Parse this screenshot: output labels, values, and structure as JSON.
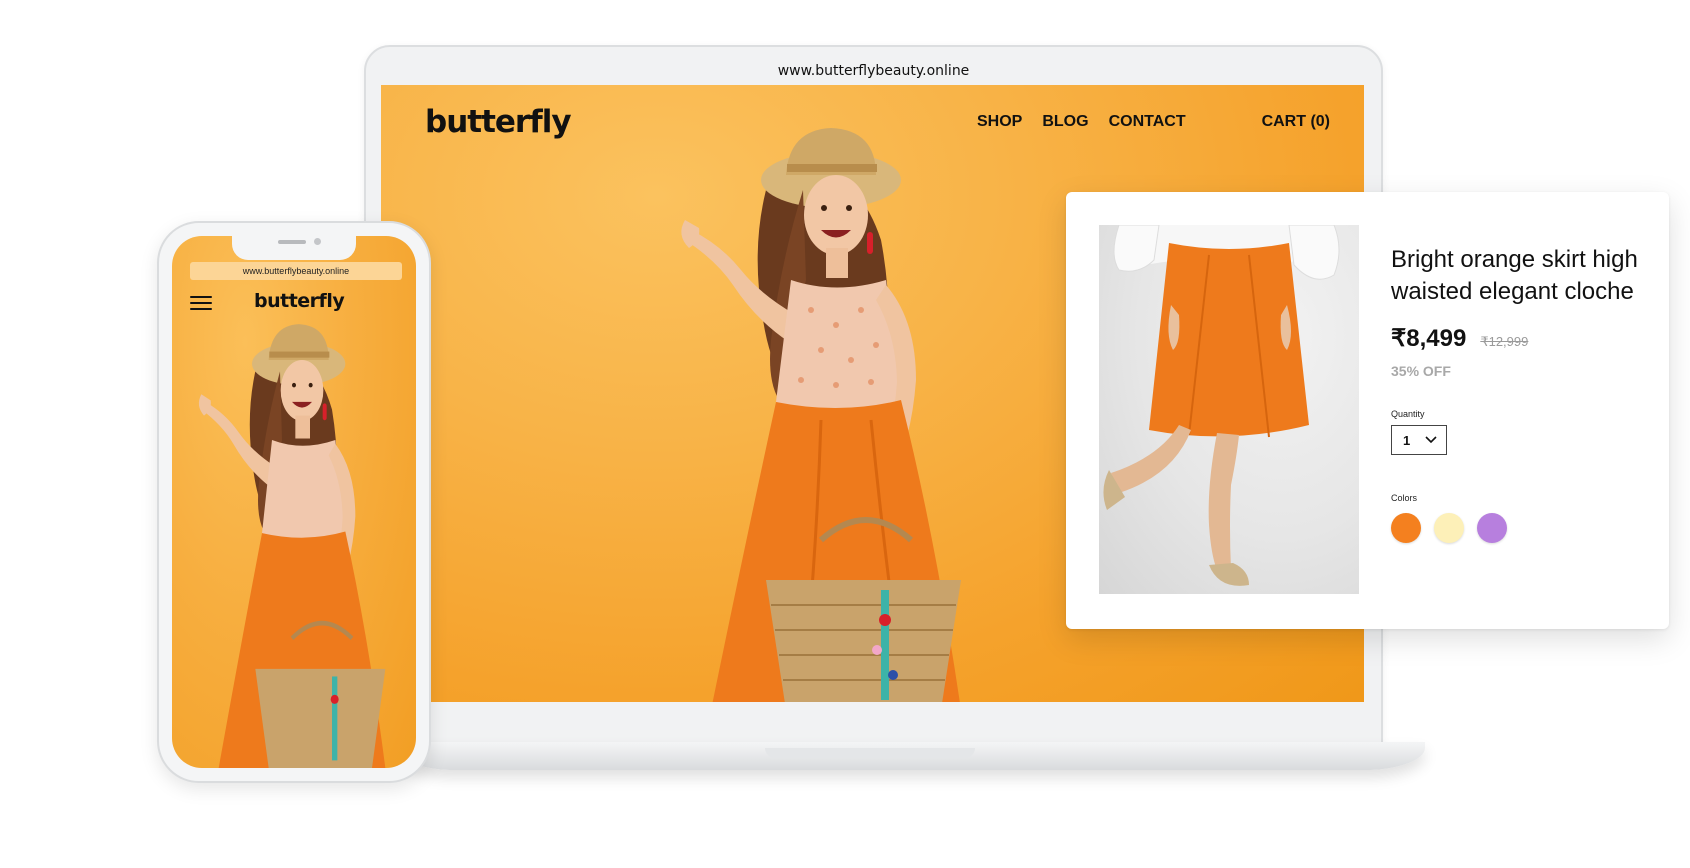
{
  "desktop": {
    "url": "www.butterflybeauty.online",
    "logo": "butterfly",
    "nav": [
      "SHOP",
      "BLOG",
      "CONTACT"
    ],
    "cart": "CART (0)"
  },
  "mobile": {
    "url": "www.butterflybeauty.online",
    "logo": "butterfly",
    "menu_icon": "hamburger-menu-icon"
  },
  "product": {
    "title": "Bright orange skirt high waisted elegant cloche",
    "price": "₹8,499",
    "old_price": "₹12,999",
    "discount": "35% OFF",
    "quantity_label": "Quantity",
    "quantity_value": "1",
    "colors_label": "Colors",
    "colors": [
      "#f4801f",
      "#fdf0b8",
      "#b77fde"
    ]
  },
  "theme": {
    "background_orange": "#f5a22c",
    "skirt_orange": "#ee7a1c"
  }
}
